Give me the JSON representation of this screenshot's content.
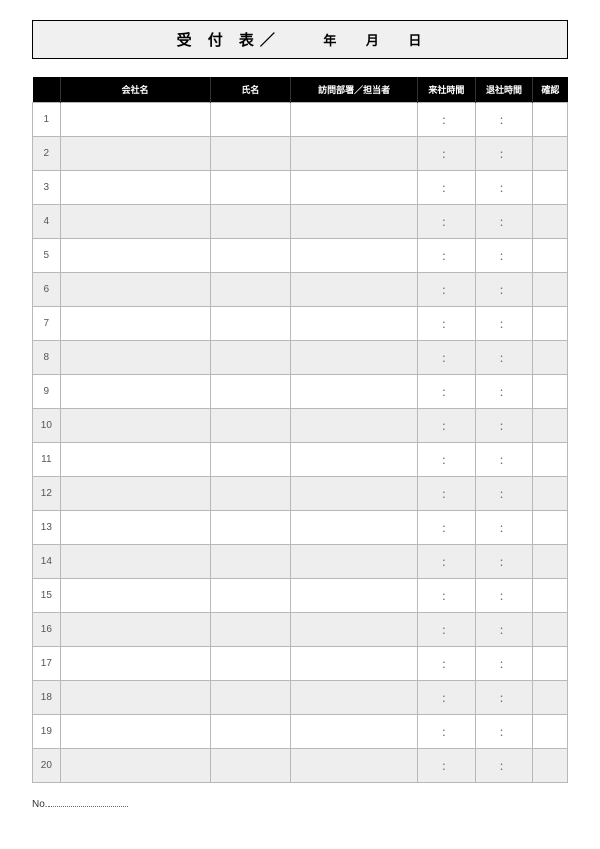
{
  "header": {
    "title": "受 付 表／",
    "date_year_label": "年",
    "date_month_label": "月",
    "date_day_label": "日"
  },
  "columns": {
    "num": "",
    "company": "会社名",
    "name": "氏名",
    "department": "訪問部署／担当者",
    "arrive": "来社時間",
    "leave": "退社時間",
    "check": "確認"
  },
  "rows": [
    {
      "num": "1",
      "company": "",
      "name": "",
      "department": "",
      "arrive": "：",
      "leave": "：",
      "check": ""
    },
    {
      "num": "2",
      "company": "",
      "name": "",
      "department": "",
      "arrive": "：",
      "leave": "：",
      "check": ""
    },
    {
      "num": "3",
      "company": "",
      "name": "",
      "department": "",
      "arrive": "：",
      "leave": "：",
      "check": ""
    },
    {
      "num": "4",
      "company": "",
      "name": "",
      "department": "",
      "arrive": "：",
      "leave": "：",
      "check": ""
    },
    {
      "num": "5",
      "company": "",
      "name": "",
      "department": "",
      "arrive": "：",
      "leave": "：",
      "check": ""
    },
    {
      "num": "6",
      "company": "",
      "name": "",
      "department": "",
      "arrive": "：",
      "leave": "：",
      "check": ""
    },
    {
      "num": "7",
      "company": "",
      "name": "",
      "department": "",
      "arrive": "：",
      "leave": "：",
      "check": ""
    },
    {
      "num": "8",
      "company": "",
      "name": "",
      "department": "",
      "arrive": "：",
      "leave": "：",
      "check": ""
    },
    {
      "num": "9",
      "company": "",
      "name": "",
      "department": "",
      "arrive": "：",
      "leave": "：",
      "check": ""
    },
    {
      "num": "10",
      "company": "",
      "name": "",
      "department": "",
      "arrive": "：",
      "leave": "：",
      "check": ""
    },
    {
      "num": "11",
      "company": "",
      "name": "",
      "department": "",
      "arrive": "：",
      "leave": "：",
      "check": ""
    },
    {
      "num": "12",
      "company": "",
      "name": "",
      "department": "",
      "arrive": "：",
      "leave": "：",
      "check": ""
    },
    {
      "num": "13",
      "company": "",
      "name": "",
      "department": "",
      "arrive": "：",
      "leave": "：",
      "check": ""
    },
    {
      "num": "14",
      "company": "",
      "name": "",
      "department": "",
      "arrive": "：",
      "leave": "：",
      "check": ""
    },
    {
      "num": "15",
      "company": "",
      "name": "",
      "department": "",
      "arrive": "：",
      "leave": "：",
      "check": ""
    },
    {
      "num": "16",
      "company": "",
      "name": "",
      "department": "",
      "arrive": "：",
      "leave": "：",
      "check": ""
    },
    {
      "num": "17",
      "company": "",
      "name": "",
      "department": "",
      "arrive": "：",
      "leave": "：",
      "check": ""
    },
    {
      "num": "18",
      "company": "",
      "name": "",
      "department": "",
      "arrive": "：",
      "leave": "：",
      "check": ""
    },
    {
      "num": "19",
      "company": "",
      "name": "",
      "department": "",
      "arrive": "：",
      "leave": "：",
      "check": ""
    },
    {
      "num": "20",
      "company": "",
      "name": "",
      "department": "",
      "arrive": "：",
      "leave": "：",
      "check": ""
    }
  ],
  "footer": {
    "no_label": "No."
  }
}
